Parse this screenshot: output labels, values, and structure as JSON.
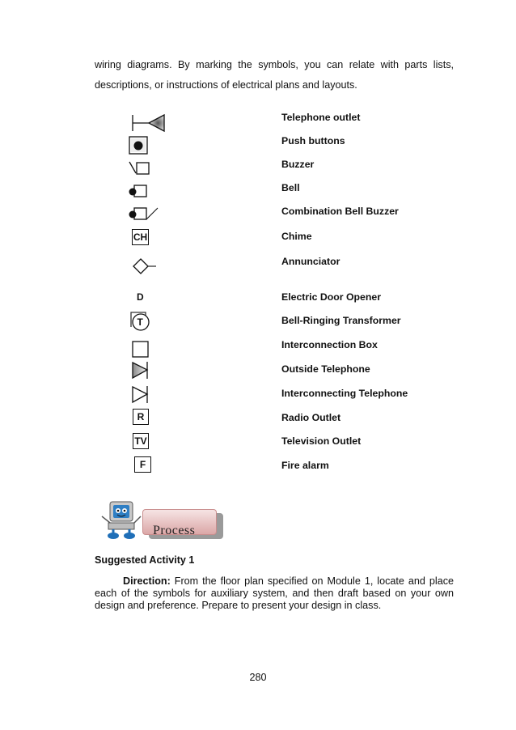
{
  "intro": {
    "line1": "wiring diagrams. By marking the symbols, you can relate with parts lists,",
    "line2": "descriptions, or instructions of electrical plans and layouts."
  },
  "symbols": [
    {
      "icon": "telephone-outlet-icon",
      "label": "Telephone outlet"
    },
    {
      "icon": "push-button-icon",
      "label": "Push buttons"
    },
    {
      "icon": "buzzer-icon",
      "label": "Buzzer"
    },
    {
      "icon": "bell-icon",
      "label": "Bell"
    },
    {
      "icon": "combination-bell-buzzer-icon",
      "label": "Combination Bell Buzzer"
    },
    {
      "icon": "chime-icon",
      "glyph": "CH",
      "label": "Chime"
    },
    {
      "icon": "annunciator-icon",
      "label": "Annunciator"
    },
    {
      "icon": "electric-door-opener-icon",
      "glyph": "D",
      "label": "Electric Door Opener"
    },
    {
      "icon": "bell-ringing-transformer-icon",
      "glyph": "T",
      "label": "Bell-Ringing Transformer"
    },
    {
      "icon": "interconnection-box-icon",
      "label": "Interconnection Box"
    },
    {
      "icon": "outside-telephone-icon",
      "label": "Outside Telephone"
    },
    {
      "icon": "interconnecting-telephone-icon",
      "label": "Interconnecting Telephone"
    },
    {
      "icon": "radio-outlet-icon",
      "glyph": "R",
      "label": "Radio Outlet"
    },
    {
      "icon": "television-outlet-icon",
      "glyph": "TV",
      "label": "Television Outlet"
    },
    {
      "icon": "fire-alarm-icon",
      "glyph": "F",
      "label": "Fire alarm"
    }
  ],
  "process_banner": {
    "label": "Process"
  },
  "activity": {
    "heading": "Suggested Activity 1",
    "direction_lead": "Direction:",
    "direction_text": " From the floor plan specified on Module 1, locate and place each of the symbols for auxiliary system, and then draft based on your own design and preference. Prepare to present your design in class."
  },
  "page_number": "280"
}
